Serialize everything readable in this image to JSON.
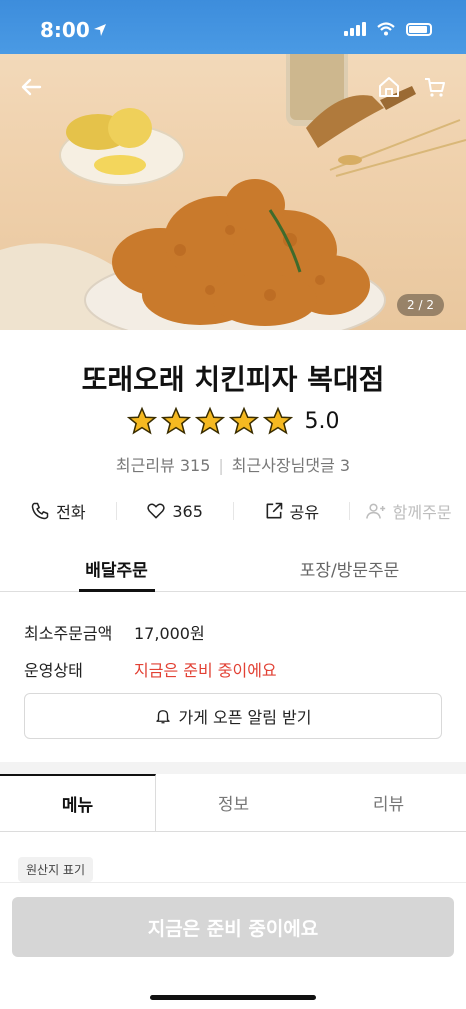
{
  "status_bar": {
    "time": "8:00"
  },
  "hero": {
    "image_counter": "2 / 2"
  },
  "store": {
    "name": "또래오래 치킨피자 복대점",
    "rating": "5.0",
    "recent_reviews": "최근리뷰 315",
    "owner_replies": "최근사장님댓글 3"
  },
  "actions": {
    "call": "전화",
    "likes": "365",
    "share": "공유",
    "group_order": "함께주문"
  },
  "order_tabs": {
    "delivery": "배달주문",
    "pickup": "포장/방문주문"
  },
  "info": {
    "min_order_label": "최소주문금액",
    "min_order_value": "17,000원",
    "status_label": "운영상태",
    "status_value": "지금은 준비 중이에요",
    "alert_button": "가게 오픈 알림 받기"
  },
  "menu_tabs": {
    "menu": "메뉴",
    "info": "정보",
    "reviews": "리뷰"
  },
  "origin_chip": "원산지 표기",
  "cta": "지금은 준비 중이에요",
  "colors": {
    "status_red": "#e24134",
    "star": "#f5b921",
    "status_bar_blue": "#3d8ddc",
    "cta_disabled": "#d6d6d6"
  }
}
